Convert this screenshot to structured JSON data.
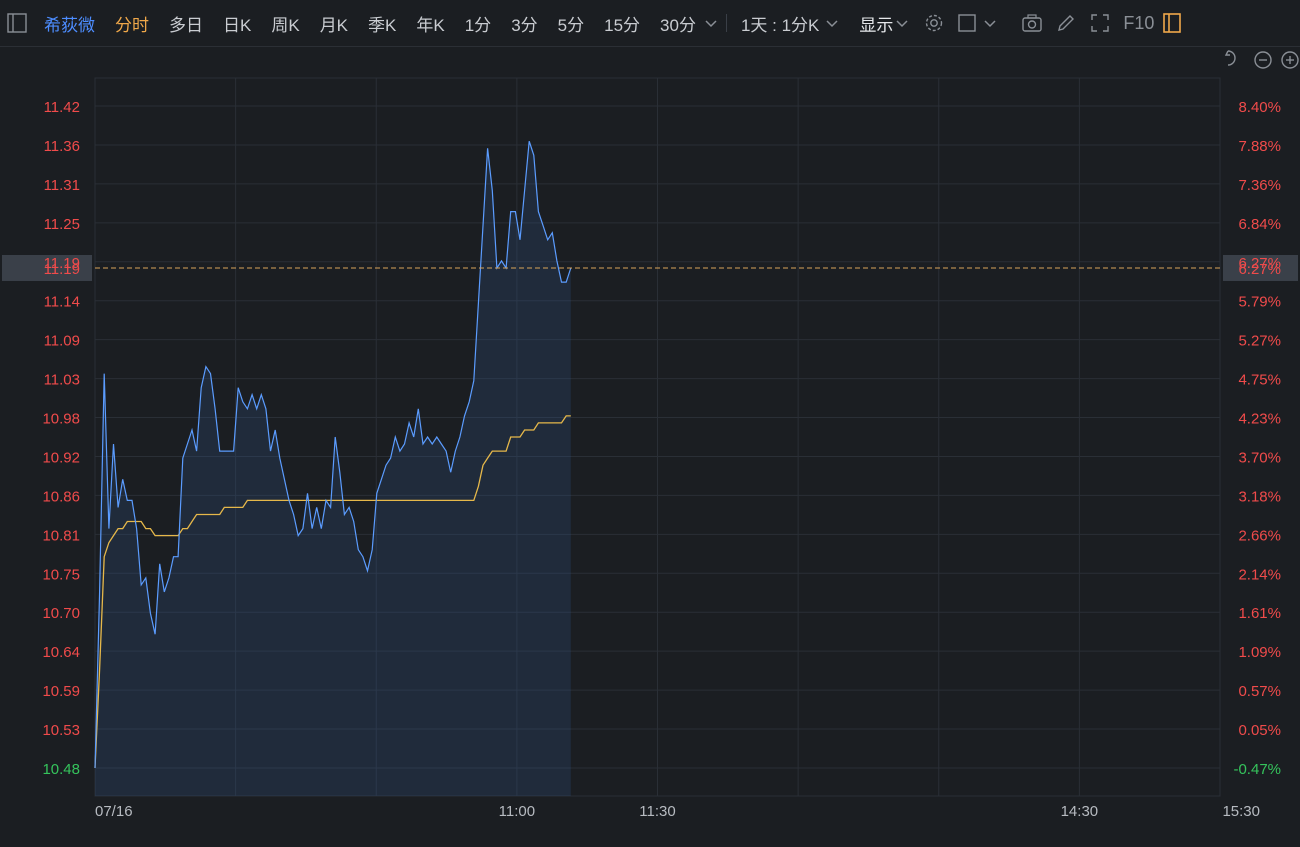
{
  "toolbar": {
    "stock_name": "希荻微",
    "tabs": [
      "分时",
      "多日",
      "日K",
      "周K",
      "月K",
      "季K",
      "年K",
      "1分",
      "3分",
      "5分",
      "15分",
      "30分"
    ],
    "active_tab": "分时",
    "period_select": "1天 : 1分K",
    "display_menu": "显示",
    "f10": "F10",
    "colors": {
      "active": "#f0a84a",
      "name": "#4d8dff",
      "text": "#c9ccd1"
    }
  },
  "chart_data": {
    "type": "line",
    "title": "",
    "xlabel": "",
    "ylabel": "",
    "x_ticks": [
      "07/16",
      "11:00",
      "11:30",
      "14:30",
      "15:30"
    ],
    "y_ticks_left": [
      "11.42",
      "11.36",
      "11.31",
      "11.25",
      "11.19",
      "11.14",
      "11.09",
      "11.03",
      "10.98",
      "10.92",
      "10.86",
      "10.81",
      "10.75",
      "10.70",
      "10.64",
      "10.59",
      "10.53",
      "10.48"
    ],
    "y_ticks_right": [
      "8.40%",
      "7.88%",
      "7.36%",
      "6.84%",
      "6.27%",
      "5.79%",
      "5.27%",
      "4.75%",
      "4.23%",
      "3.70%",
      "3.18%",
      "2.66%",
      "2.14%",
      "1.61%",
      "1.09%",
      "0.57%",
      "0.05%",
      "-0.47%"
    ],
    "ylim": [
      10.48,
      11.42
    ],
    "current_price_label": "11.19",
    "current_pct_label": "6.27%",
    "current_price": 11.19,
    "x_minutes_total": 240,
    "series": [
      {
        "name": "price",
        "color": "#5b9cff",
        "values": [
          10.48,
          10.73,
          11.04,
          10.82,
          10.94,
          10.85,
          10.89,
          10.86,
          10.86,
          10.82,
          10.74,
          10.75,
          10.7,
          10.67,
          10.77,
          10.73,
          10.75,
          10.78,
          10.78,
          10.92,
          10.94,
          10.96,
          10.93,
          11.02,
          11.05,
          11.04,
          10.99,
          10.93,
          10.93,
          10.93,
          10.93,
          11.02,
          11.0,
          10.99,
          11.01,
          10.99,
          11.01,
          10.99,
          10.93,
          10.96,
          10.92,
          10.89,
          10.86,
          10.84,
          10.81,
          10.82,
          10.87,
          10.82,
          10.85,
          10.82,
          10.86,
          10.85,
          10.95,
          10.9,
          10.84,
          10.85,
          10.83,
          10.79,
          10.78,
          10.76,
          10.79,
          10.87,
          10.89,
          10.91,
          10.92,
          10.95,
          10.93,
          10.94,
          10.97,
          10.95,
          10.99,
          10.94,
          10.95,
          10.94,
          10.95,
          10.94,
          10.93,
          10.9,
          10.93,
          10.95,
          10.98,
          11.0,
          11.03,
          11.14,
          11.25,
          11.36,
          11.3,
          11.19,
          11.2,
          11.19,
          11.27,
          11.27,
          11.23,
          11.3,
          11.37,
          11.35,
          11.27,
          11.25,
          11.23,
          11.24,
          11.2,
          11.17,
          11.17,
          11.19
        ],
        "start_minute": 0
      },
      {
        "name": "avg",
        "color": "#e6b84a",
        "values": [
          10.48,
          10.62,
          10.78,
          10.8,
          10.81,
          10.82,
          10.82,
          10.83,
          10.83,
          10.83,
          10.83,
          10.82,
          10.82,
          10.81,
          10.81,
          10.81,
          10.81,
          10.81,
          10.81,
          10.82,
          10.82,
          10.83,
          10.84,
          10.84,
          10.84,
          10.84,
          10.84,
          10.84,
          10.85,
          10.85,
          10.85,
          10.85,
          10.85,
          10.86,
          10.86,
          10.86,
          10.86,
          10.86,
          10.86,
          10.86,
          10.86,
          10.86,
          10.86,
          10.86,
          10.86,
          10.86,
          10.86,
          10.86,
          10.86,
          10.86,
          10.86,
          10.86,
          10.86,
          10.86,
          10.86,
          10.86,
          10.86,
          10.86,
          10.86,
          10.86,
          10.86,
          10.86,
          10.86,
          10.86,
          10.86,
          10.86,
          10.86,
          10.86,
          10.86,
          10.86,
          10.86,
          10.86,
          10.86,
          10.86,
          10.86,
          10.86,
          10.86,
          10.86,
          10.86,
          10.86,
          10.86,
          10.86,
          10.86,
          10.88,
          10.91,
          10.92,
          10.93,
          10.93,
          10.93,
          10.93,
          10.95,
          10.95,
          10.95,
          10.96,
          10.96,
          10.96,
          10.97,
          10.97,
          10.97,
          10.97,
          10.97,
          10.97,
          10.98,
          10.98
        ],
        "start_minute": 0
      }
    ],
    "grid": true,
    "colors": {
      "up": "#f04b4b",
      "down": "#35c45c",
      "grid": "#2a2f36",
      "dash": "#d9a45a"
    }
  }
}
